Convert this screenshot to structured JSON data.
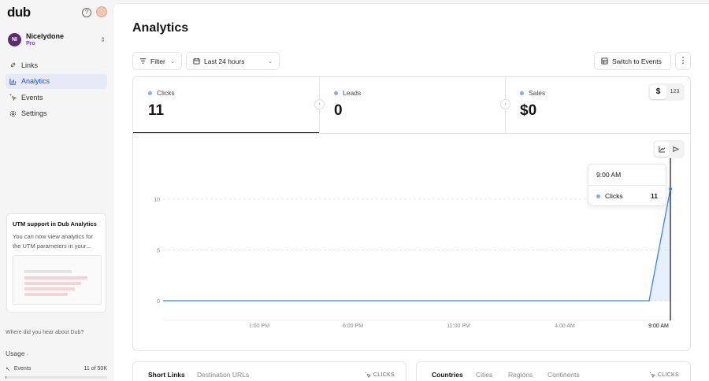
{
  "app": {
    "logo": "dub"
  },
  "workspace": {
    "initials": "NI",
    "name": "Nicelydone",
    "plan": "Pro"
  },
  "nav": [
    {
      "label": "Links",
      "icon": "link-icon"
    },
    {
      "label": "Analytics",
      "icon": "bar-chart-icon",
      "active": true
    },
    {
      "label": "Events",
      "icon": "cursor-click-icon"
    },
    {
      "label": "Settings",
      "icon": "gear-icon"
    }
  ],
  "promo": {
    "title": "UTM support in Dub Analytics",
    "body": "You can now view analytics for the UTM parameters in your..."
  },
  "survey": "Where did you hear about Dub?",
  "usage": {
    "label": "Usage",
    "events_label": "Events",
    "events_count": "11 of 50K",
    "fraction": 0.0002
  },
  "page": {
    "title": "Analytics"
  },
  "toolbar": {
    "filter_label": "Filter",
    "range_label": "Last 24 hours",
    "switch_label": "Switch to Events"
  },
  "stats": [
    {
      "label": "Clicks",
      "value": "11"
    },
    {
      "label": "Leads",
      "value": "0"
    },
    {
      "label": "Sales",
      "value": "$0"
    }
  ],
  "currency_toggle": {
    "options": [
      "$",
      "123"
    ],
    "selected": "$"
  },
  "tooltip": {
    "time": "9:00 AM",
    "label": "Clicks",
    "value": "11"
  },
  "chart_data": {
    "type": "area",
    "x": [
      "1:00 PM",
      "6:00 PM",
      "11:00 PM",
      "4:00 AM",
      "9:00 AM"
    ],
    "series": [
      {
        "name": "Clicks",
        "values": [
          0,
          0,
          0,
          0,
          11
        ]
      }
    ],
    "yticks": [
      "10",
      "5",
      "0"
    ],
    "ylim": [
      0,
      11
    ],
    "grid": true,
    "color": "#3b82f6"
  },
  "bottom_left": {
    "tabs": [
      "Short Links",
      "Destination URLs"
    ],
    "metric": "CLICKS"
  },
  "bottom_right": {
    "tabs": [
      "Countries",
      "Cities",
      "Regions",
      "Continents"
    ],
    "metric": "CLICKS"
  }
}
